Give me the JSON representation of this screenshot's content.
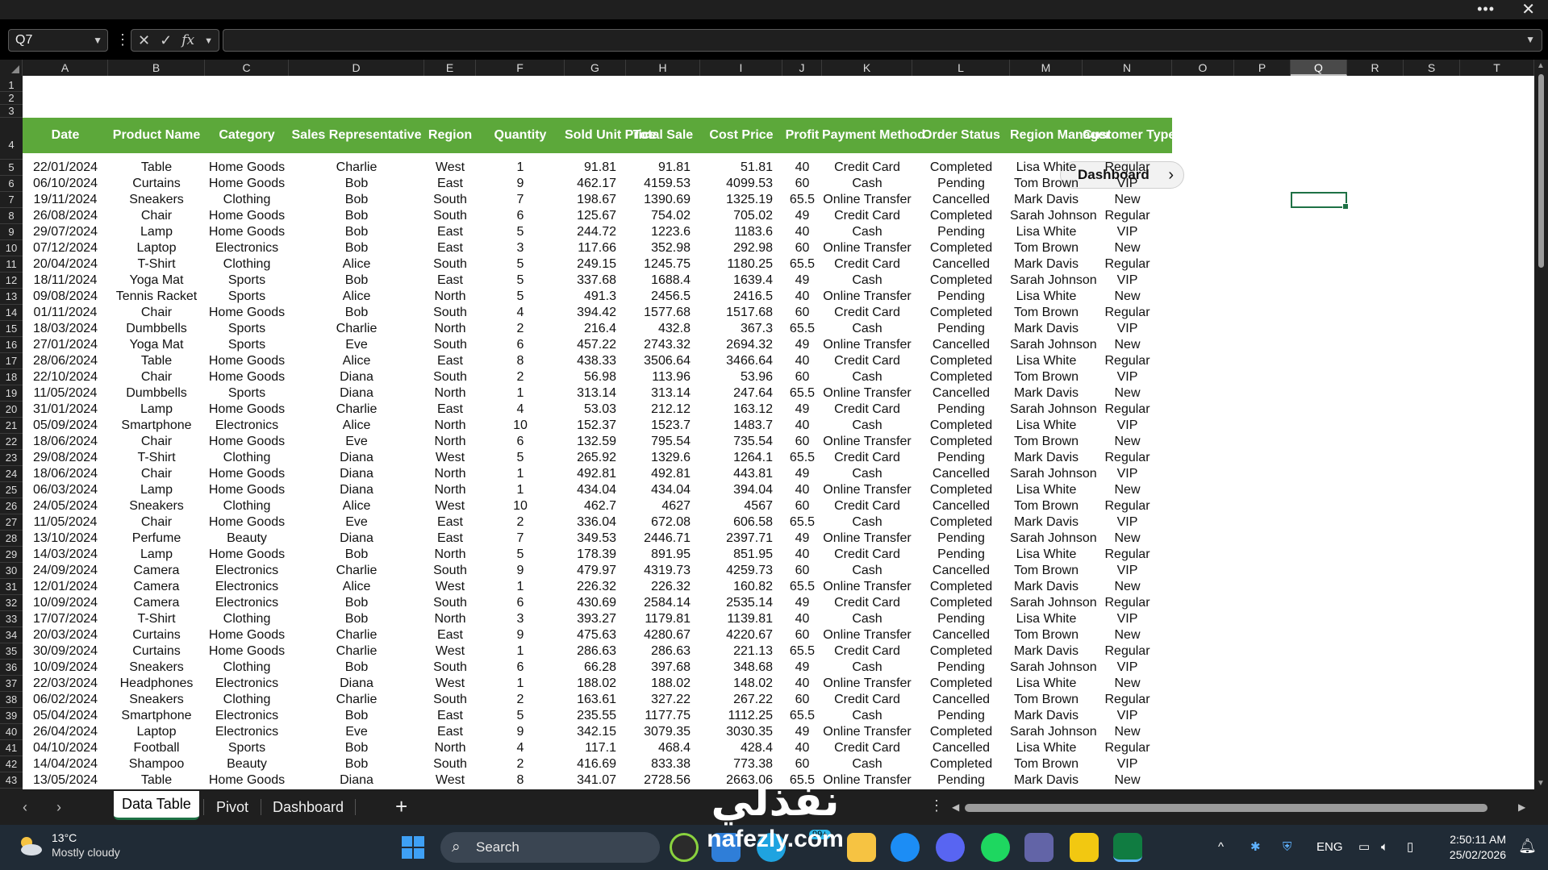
{
  "window": {
    "more_glyph": "•••",
    "close_glyph": "✕"
  },
  "formula_bar": {
    "name_box": "Q7",
    "formula": ""
  },
  "columns": [
    "A",
    "B",
    "C",
    "D",
    "E",
    "F",
    "G",
    "H",
    "I",
    "J",
    "K",
    "L",
    "M",
    "N",
    "O",
    "P",
    "Q",
    "R",
    "S",
    "T"
  ],
  "active_column": "Q",
  "rows_start": 1,
  "rows_count": 43,
  "dashboard_button": "Dashboard",
  "table_headers": [
    "Date",
    "Product Name",
    "Category",
    "Sales Representative",
    "Region",
    "Quantity",
    "Sold Unit Price",
    "Total Sale",
    "Cost Price",
    "Profit",
    "Payment Method",
    "Order Status",
    "Region Manager",
    "Customer Type"
  ],
  "table_rows": [
    [
      "22/01/2024",
      "Table",
      "Home Goods",
      "Charlie",
      "West",
      "1",
      "91.81",
      "91.81",
      "51.81",
      "40",
      "Credit Card",
      "Completed",
      "Lisa White",
      "Regular"
    ],
    [
      "06/10/2024",
      "Curtains",
      "Home Goods",
      "Bob",
      "East",
      "9",
      "462.17",
      "4159.53",
      "4099.53",
      "60",
      "Cash",
      "Pending",
      "Tom Brown",
      "VIP"
    ],
    [
      "19/11/2024",
      "Sneakers",
      "Clothing",
      "Bob",
      "South",
      "7",
      "198.67",
      "1390.69",
      "1325.19",
      "65.5",
      "Online Transfer",
      "Cancelled",
      "Mark Davis",
      "New"
    ],
    [
      "26/08/2024",
      "Chair",
      "Home Goods",
      "Bob",
      "South",
      "6",
      "125.67",
      "754.02",
      "705.02",
      "49",
      "Credit Card",
      "Completed",
      "Sarah Johnson",
      "Regular"
    ],
    [
      "29/07/2024",
      "Lamp",
      "Home Goods",
      "Bob",
      "East",
      "5",
      "244.72",
      "1223.6",
      "1183.6",
      "40",
      "Cash",
      "Pending",
      "Lisa White",
      "VIP"
    ],
    [
      "07/12/2024",
      "Laptop",
      "Electronics",
      "Bob",
      "East",
      "3",
      "117.66",
      "352.98",
      "292.98",
      "60",
      "Online Transfer",
      "Completed",
      "Tom Brown",
      "New"
    ],
    [
      "20/04/2024",
      "T-Shirt",
      "Clothing",
      "Alice",
      "South",
      "5",
      "249.15",
      "1245.75",
      "1180.25",
      "65.5",
      "Credit Card",
      "Cancelled",
      "Mark Davis",
      "Regular"
    ],
    [
      "18/11/2024",
      "Yoga Mat",
      "Sports",
      "Bob",
      "East",
      "5",
      "337.68",
      "1688.4",
      "1639.4",
      "49",
      "Cash",
      "Completed",
      "Sarah Johnson",
      "VIP"
    ],
    [
      "09/08/2024",
      "Tennis Racket",
      "Sports",
      "Alice",
      "North",
      "5",
      "491.3",
      "2456.5",
      "2416.5",
      "40",
      "Online Transfer",
      "Pending",
      "Lisa White",
      "New"
    ],
    [
      "01/11/2024",
      "Chair",
      "Home Goods",
      "Bob",
      "South",
      "4",
      "394.42",
      "1577.68",
      "1517.68",
      "60",
      "Credit Card",
      "Completed",
      "Tom Brown",
      "Regular"
    ],
    [
      "18/03/2024",
      "Dumbbells",
      "Sports",
      "Charlie",
      "North",
      "2",
      "216.4",
      "432.8",
      "367.3",
      "65.5",
      "Cash",
      "Pending",
      "Mark Davis",
      "VIP"
    ],
    [
      "27/01/2024",
      "Yoga Mat",
      "Sports",
      "Eve",
      "South",
      "6",
      "457.22",
      "2743.32",
      "2694.32",
      "49",
      "Online Transfer",
      "Cancelled",
      "Sarah Johnson",
      "New"
    ],
    [
      "28/06/2024",
      "Table",
      "Home Goods",
      "Alice",
      "East",
      "8",
      "438.33",
      "3506.64",
      "3466.64",
      "40",
      "Credit Card",
      "Completed",
      "Lisa White",
      "Regular"
    ],
    [
      "22/10/2024",
      "Chair",
      "Home Goods",
      "Diana",
      "South",
      "2",
      "56.98",
      "113.96",
      "53.96",
      "60",
      "Cash",
      "Completed",
      "Tom Brown",
      "VIP"
    ],
    [
      "11/05/2024",
      "Dumbbells",
      "Sports",
      "Diana",
      "North",
      "1",
      "313.14",
      "313.14",
      "247.64",
      "65.5",
      "Online Transfer",
      "Cancelled",
      "Mark Davis",
      "New"
    ],
    [
      "31/01/2024",
      "Lamp",
      "Home Goods",
      "Charlie",
      "East",
      "4",
      "53.03",
      "212.12",
      "163.12",
      "49",
      "Credit Card",
      "Pending",
      "Sarah Johnson",
      "Regular"
    ],
    [
      "05/09/2024",
      "Smartphone",
      "Electronics",
      "Alice",
      "North",
      "10",
      "152.37",
      "1523.7",
      "1483.7",
      "40",
      "Cash",
      "Completed",
      "Lisa White",
      "VIP"
    ],
    [
      "18/06/2024",
      "Chair",
      "Home Goods",
      "Eve",
      "North",
      "6",
      "132.59",
      "795.54",
      "735.54",
      "60",
      "Online Transfer",
      "Completed",
      "Tom Brown",
      "New"
    ],
    [
      "29/08/2024",
      "T-Shirt",
      "Clothing",
      "Diana",
      "West",
      "5",
      "265.92",
      "1329.6",
      "1264.1",
      "65.5",
      "Credit Card",
      "Pending",
      "Mark Davis",
      "Regular"
    ],
    [
      "18/06/2024",
      "Chair",
      "Home Goods",
      "Diana",
      "North",
      "1",
      "492.81",
      "492.81",
      "443.81",
      "49",
      "Cash",
      "Cancelled",
      "Sarah Johnson",
      "VIP"
    ],
    [
      "06/03/2024",
      "Lamp",
      "Home Goods",
      "Diana",
      "North",
      "1",
      "434.04",
      "434.04",
      "394.04",
      "40",
      "Online Transfer",
      "Completed",
      "Lisa White",
      "New"
    ],
    [
      "24/05/2024",
      "Sneakers",
      "Clothing",
      "Alice",
      "West",
      "10",
      "462.7",
      "4627",
      "4567",
      "60",
      "Credit Card",
      "Cancelled",
      "Tom Brown",
      "Regular"
    ],
    [
      "11/05/2024",
      "Chair",
      "Home Goods",
      "Eve",
      "East",
      "2",
      "336.04",
      "672.08",
      "606.58",
      "65.5",
      "Cash",
      "Completed",
      "Mark Davis",
      "VIP"
    ],
    [
      "13/10/2024",
      "Perfume",
      "Beauty",
      "Diana",
      "East",
      "7",
      "349.53",
      "2446.71",
      "2397.71",
      "49",
      "Online Transfer",
      "Pending",
      "Sarah Johnson",
      "New"
    ],
    [
      "14/03/2024",
      "Lamp",
      "Home Goods",
      "Bob",
      "North",
      "5",
      "178.39",
      "891.95",
      "851.95",
      "40",
      "Credit Card",
      "Pending",
      "Lisa White",
      "Regular"
    ],
    [
      "24/09/2024",
      "Camera",
      "Electronics",
      "Charlie",
      "South",
      "9",
      "479.97",
      "4319.73",
      "4259.73",
      "60",
      "Cash",
      "Cancelled",
      "Tom Brown",
      "VIP"
    ],
    [
      "12/01/2024",
      "Camera",
      "Electronics",
      "Alice",
      "West",
      "1",
      "226.32",
      "226.32",
      "160.82",
      "65.5",
      "Online Transfer",
      "Completed",
      "Mark Davis",
      "New"
    ],
    [
      "10/09/2024",
      "Camera",
      "Electronics",
      "Bob",
      "South",
      "6",
      "430.69",
      "2584.14",
      "2535.14",
      "49",
      "Credit Card",
      "Completed",
      "Sarah Johnson",
      "Regular"
    ],
    [
      "17/07/2024",
      "T-Shirt",
      "Clothing",
      "Bob",
      "North",
      "3",
      "393.27",
      "1179.81",
      "1139.81",
      "40",
      "Cash",
      "Pending",
      "Lisa White",
      "VIP"
    ],
    [
      "20/03/2024",
      "Curtains",
      "Home Goods",
      "Charlie",
      "East",
      "9",
      "475.63",
      "4280.67",
      "4220.67",
      "60",
      "Online Transfer",
      "Cancelled",
      "Tom Brown",
      "New"
    ],
    [
      "30/09/2024",
      "Curtains",
      "Home Goods",
      "Charlie",
      "West",
      "1",
      "286.63",
      "286.63",
      "221.13",
      "65.5",
      "Credit Card",
      "Completed",
      "Mark Davis",
      "Regular"
    ],
    [
      "10/09/2024",
      "Sneakers",
      "Clothing",
      "Bob",
      "South",
      "6",
      "66.28",
      "397.68",
      "348.68",
      "49",
      "Cash",
      "Pending",
      "Sarah Johnson",
      "VIP"
    ],
    [
      "22/03/2024",
      "Headphones",
      "Electronics",
      "Diana",
      "West",
      "1",
      "188.02",
      "188.02",
      "148.02",
      "40",
      "Online Transfer",
      "Completed",
      "Lisa White",
      "New"
    ],
    [
      "06/02/2024",
      "Sneakers",
      "Clothing",
      "Charlie",
      "South",
      "2",
      "163.61",
      "327.22",
      "267.22",
      "60",
      "Credit Card",
      "Cancelled",
      "Tom Brown",
      "Regular"
    ],
    [
      "05/04/2024",
      "Smartphone",
      "Electronics",
      "Bob",
      "East",
      "5",
      "235.55",
      "1177.75",
      "1112.25",
      "65.5",
      "Cash",
      "Pending",
      "Mark Davis",
      "VIP"
    ],
    [
      "26/04/2024",
      "Laptop",
      "Electronics",
      "Eve",
      "East",
      "9",
      "342.15",
      "3079.35",
      "3030.35",
      "49",
      "Online Transfer",
      "Completed",
      "Sarah Johnson",
      "New"
    ],
    [
      "04/10/2024",
      "Football",
      "Sports",
      "Bob",
      "North",
      "4",
      "117.1",
      "468.4",
      "428.4",
      "40",
      "Credit Card",
      "Cancelled",
      "Lisa White",
      "Regular"
    ],
    [
      "14/04/2024",
      "Shampoo",
      "Beauty",
      "Bob",
      "South",
      "2",
      "416.69",
      "833.38",
      "773.38",
      "60",
      "Cash",
      "Completed",
      "Tom Brown",
      "VIP"
    ],
    [
      "13/05/2024",
      "Table",
      "Home Goods",
      "Diana",
      "West",
      "8",
      "341.07",
      "2728.56",
      "2663.06",
      "65.5",
      "Online Transfer",
      "Pending",
      "Mark Davis",
      "New"
    ]
  ],
  "sheet_tabs": [
    "Data Table",
    "Pivot",
    "Dashboard"
  ],
  "active_tab": "Data Table",
  "add_sheet": "+",
  "taskbar": {
    "weather_temp": "13°C",
    "weather_desc": "Mostly cloudy",
    "search_label": "Search",
    "badge": "99+",
    "lang": "ENG",
    "time": "2:50:11 AM",
    "date": "25/02/2026"
  },
  "watermark": {
    "arabic": "نفذلي",
    "latin": "nafezly.com"
  },
  "colors": {
    "header_green": "#5ca83a",
    "excel_green": "#1e7145"
  }
}
